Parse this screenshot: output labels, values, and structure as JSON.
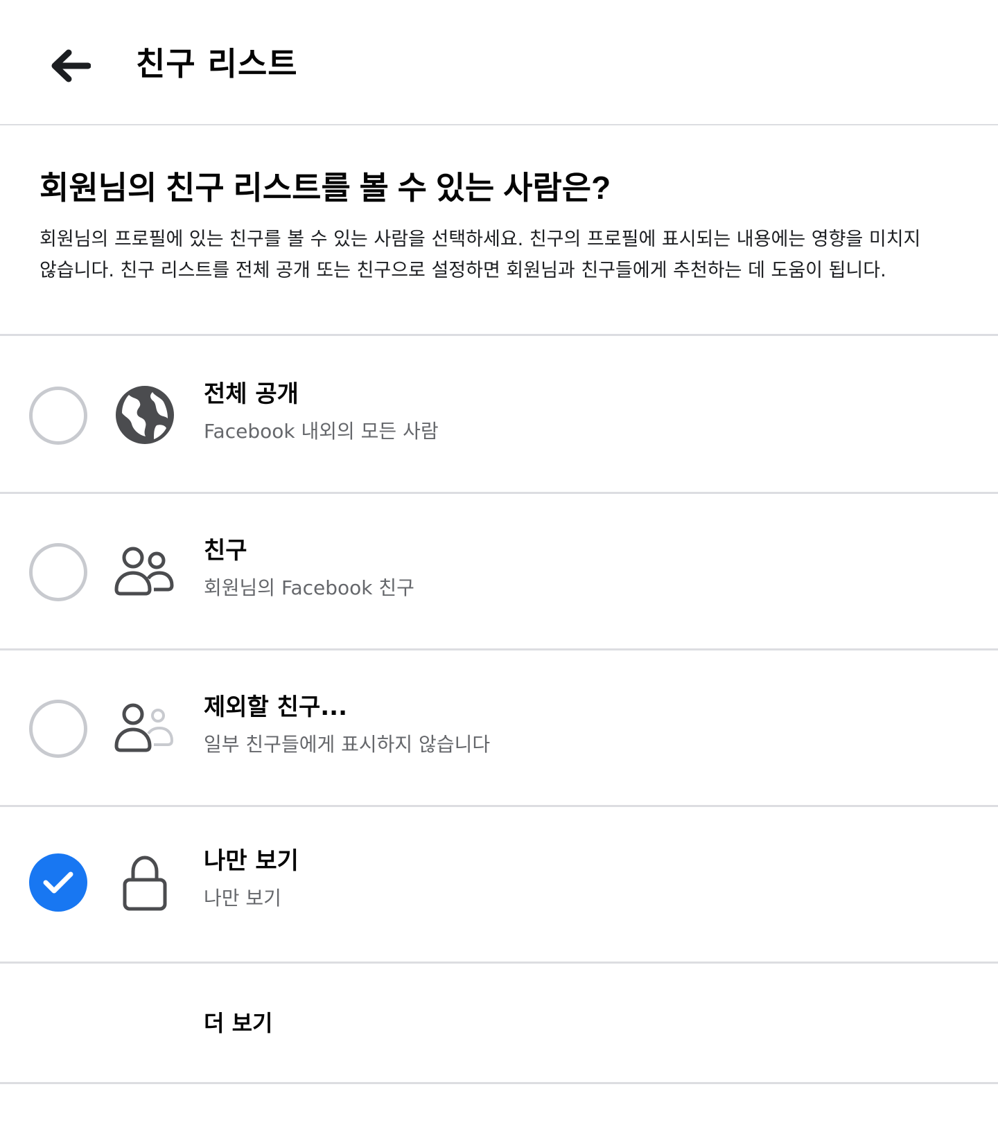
{
  "header": {
    "back_icon": "arrow-left-icon",
    "title": "친구 리스트"
  },
  "intro": {
    "question": "회원님의 친구 리스트를 볼 수 있는 사람은?",
    "description": "회원님의 프로필에 있는 친구를 볼 수 있는 사람을 선택하세요. 친구의 프로필에 표시되는 내용에는 영향을 미치지 않습니다. 친구 리스트를 전체 공개 또는 친구으로 설정하면 회원님과 친구들에게 추천하는 데 도움이 됩니다."
  },
  "options": [
    {
      "title": "전체 공개",
      "subtitle": "Facebook 내외의 모든 사람",
      "icon": "globe-icon",
      "selected": false
    },
    {
      "title": "친구",
      "subtitle": "회원님의 Facebook 친구",
      "icon": "friends-icon",
      "selected": false
    },
    {
      "title": "제외할 친구...",
      "subtitle": "일부 친구들에게 표시하지 않습니다",
      "icon": "friends-except-icon",
      "selected": false
    },
    {
      "title": "나만 보기",
      "subtitle": "나만 보기",
      "icon": "lock-icon",
      "selected": true
    }
  ],
  "more": {
    "label": "더 보기"
  },
  "colors": {
    "accent": "#1877f2",
    "divider": "#dcdde1",
    "secondary_text": "#65676b",
    "radio_border": "#c8cacf",
    "icon_dark": "#4b4c4f"
  }
}
